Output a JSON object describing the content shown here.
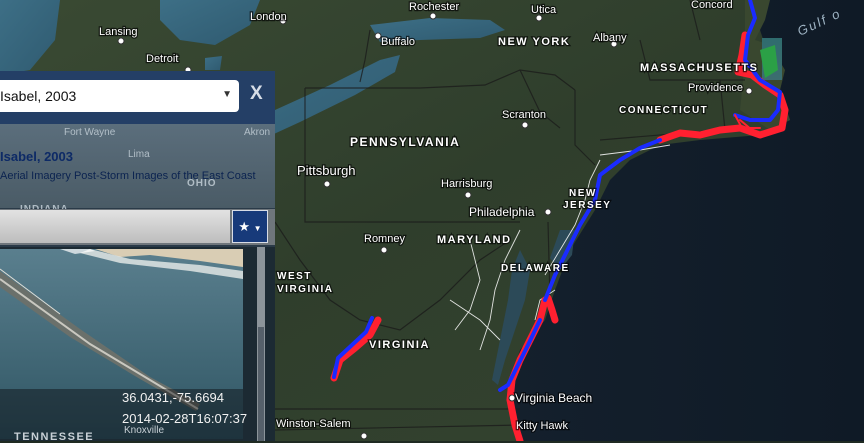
{
  "map": {
    "cities": [
      {
        "id": "rochester",
        "name": "Rochester"
      },
      {
        "id": "utica",
        "name": "Utica"
      },
      {
        "id": "concord",
        "name": "Concord"
      },
      {
        "id": "london",
        "name": "London"
      },
      {
        "id": "lansing",
        "name": "Lansing"
      },
      {
        "id": "buffalo",
        "name": "Buffalo"
      },
      {
        "id": "albany",
        "name": "Albany"
      },
      {
        "id": "detroit",
        "name": "Detroit"
      },
      {
        "id": "providence",
        "name": "Providence"
      },
      {
        "id": "scranton",
        "name": "Scranton"
      },
      {
        "id": "pittsburgh",
        "name": "Pittsburgh"
      },
      {
        "id": "harrisburg",
        "name": "Harrisburg"
      },
      {
        "id": "philadelphia",
        "name": "Philadelphia"
      },
      {
        "id": "romney",
        "name": "Romney"
      },
      {
        "id": "virginia-beach",
        "name": "Virginia Beach"
      },
      {
        "id": "winston-salem",
        "name": "Winston-Salem"
      },
      {
        "id": "kitty-hawk",
        "name": "Kitty Hawk"
      }
    ],
    "states": [
      {
        "id": "new-york",
        "name": "NEW YORK"
      },
      {
        "id": "massachusetts",
        "name": "MASSACHUSETTS"
      },
      {
        "id": "connecticut",
        "name": "CONNECTICUT"
      },
      {
        "id": "pennsylvania",
        "name": "PENNSYLVANIA"
      },
      {
        "id": "new-jersey-1",
        "name": "NEW"
      },
      {
        "id": "new-jersey-2",
        "name": "JERSEY"
      },
      {
        "id": "maryland",
        "name": "MARYLAND"
      },
      {
        "id": "delaware",
        "name": "DELAWARE"
      },
      {
        "id": "west-virginia-1",
        "name": "WEST"
      },
      {
        "id": "west-virginia-2",
        "name": "VIRGINIA"
      },
      {
        "id": "virginia",
        "name": "VIRGINIA"
      }
    ],
    "water_label": "Gulf o",
    "colors": {
      "track_outer": "#ff2030",
      "track_inner": "#1a2bff",
      "coast": "#ffffff"
    }
  },
  "panel": {
    "storm_select": "Isabel, 2003",
    "close": "X",
    "storm_title": "Isabel, 2003",
    "storm_subtitle": "Aerial Imagery Post-Storm Images of the East Coast",
    "bg_labels": {
      "fort_wayne": "Fort Wayne",
      "akron": "Akron",
      "lima": "Lima",
      "ohio": "OHIO",
      "indiana": "INDIANA"
    },
    "search_value": "",
    "star_button": "★",
    "photo": {
      "coordinates": "36.0431,-75.6694",
      "timestamp": "2014-02-28T16:07:37"
    },
    "tennessee": "TENNESSEE",
    "knoxville": "Knoxville"
  }
}
